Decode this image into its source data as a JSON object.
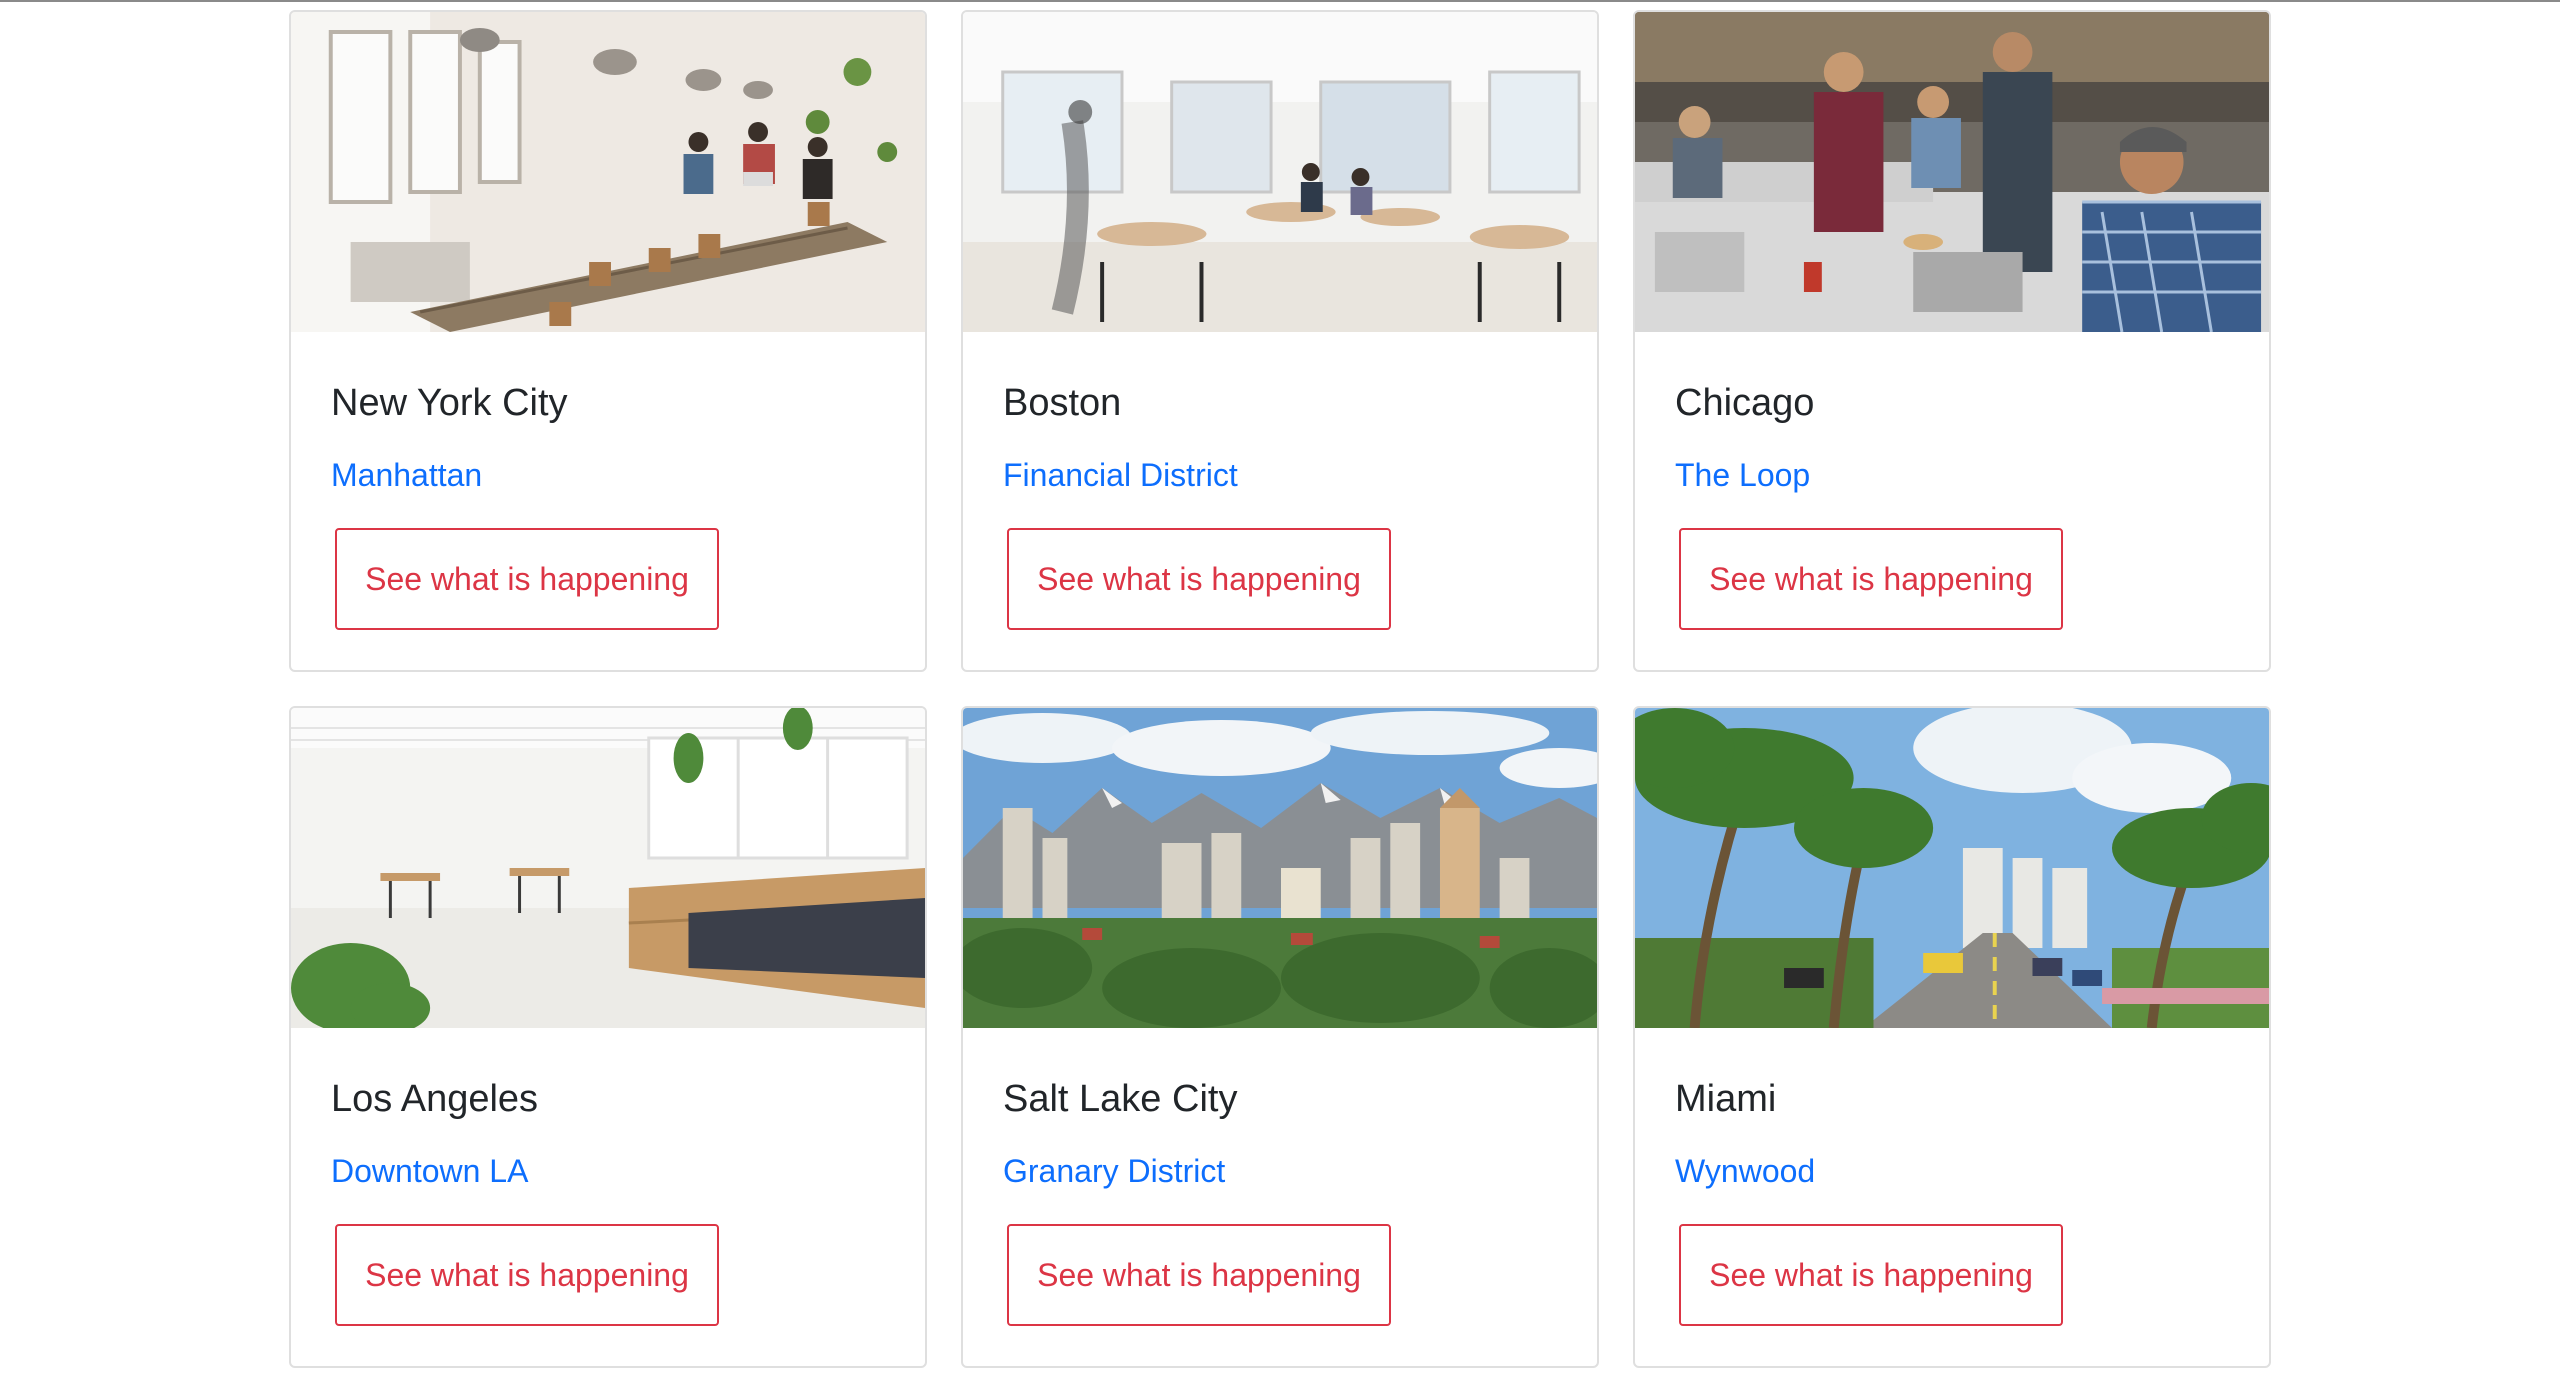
{
  "cards": [
    {
      "title": "New York City",
      "subtitle": "Manhattan",
      "button": "See what is happening",
      "image": "coworking-long-table-photo"
    },
    {
      "title": "Boston",
      "subtitle": "Financial District",
      "button": "See what is happening",
      "image": "bright-cafe-lounge-photo"
    },
    {
      "title": "Chicago",
      "subtitle": "The Loop",
      "button": "See what is happening",
      "image": "people-working-on-laptops-photo"
    },
    {
      "title": "Los Angeles",
      "subtitle": "Downtown LA",
      "button": "See what is happening",
      "image": "white-loft-with-bench-photo"
    },
    {
      "title": "Salt Lake City",
      "subtitle": "Granary District",
      "button": "See what is happening",
      "image": "city-skyline-mountains-photo"
    },
    {
      "title": "Miami",
      "subtitle": "Wynwood",
      "button": "See what is happening",
      "image": "palm-tree-street-photo"
    }
  ],
  "colors": {
    "link": "#0d6efd",
    "button_outline": "#dc3545",
    "card_border": "#dfdfdf"
  }
}
